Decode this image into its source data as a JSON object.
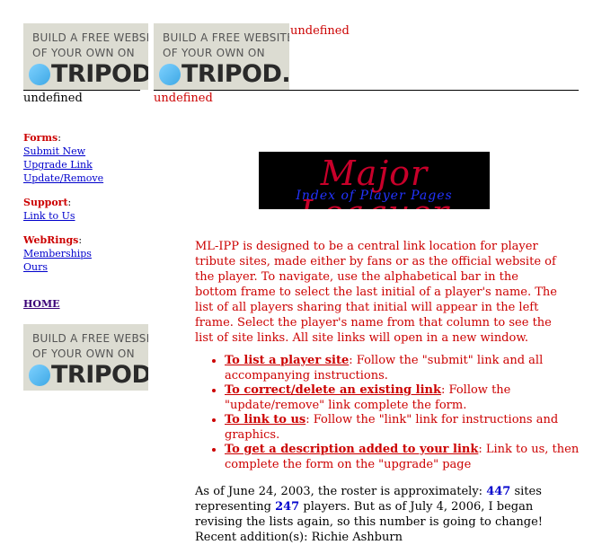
{
  "ads": {
    "line1": "BUILD A FREE WEBSITE",
    "line2": "OF YOUR OWN ON",
    "brand": "TRIPOD."
  },
  "undefined_text": "undefined",
  "nav": {
    "forms": {
      "heading": "Forms",
      "links": [
        "Submit New",
        "Upgrade Link",
        "Update/Remove"
      ]
    },
    "support": {
      "heading": "Support",
      "links": [
        "Link to Us"
      ]
    },
    "webrings": {
      "heading": "WebRings",
      "links": [
        "Memberships",
        "Ours"
      ]
    },
    "home": "HOME"
  },
  "banner": {
    "title": "Major Leaguer",
    "subtitle": "Index of Player Pages"
  },
  "intro": "ML-IPP is designed to be a central link location for player tribute sites, made either by fans or as the official website of the player. To navigate, use the alphabetical bar in the bottom frame to select the last initial of a player's name. The list of all players sharing that initial will appear in the left frame. Select the player's name from that column to see the list of site links. All site links will open in a new window.",
  "bullets": [
    {
      "link": "To list a player site",
      "text": ": Follow the \"submit\" link and all accompanying instructions."
    },
    {
      "link": "To correct/delete an existing link",
      "text": ": Follow the \"update/remove\" link complete the form."
    },
    {
      "link": "To link to us",
      "text": ": Follow the \"link\" link for instructions and graphics."
    },
    {
      "link": "To get a description added to your link",
      "text": ": Link to us, then complete the form on the \"upgrade\" page"
    }
  ],
  "stats": {
    "part1": "As of June 24, 2003, the roster is approximately: ",
    "sites": "447",
    "part2": " sites representing ",
    "players": "247",
    "part3": " players. But as of July 4, 2006, I began revising the lists again, so this number is going to change!",
    "recent": "Recent addition(s): Richie Ashburn"
  },
  "colors": {
    "accent_red": "#cc0000",
    "link_blue": "#0000cc",
    "ad_background": "#dcdcd2",
    "tripod_dot": "#3ea8e5",
    "banner_red": "#c8002a",
    "banner_blue": "#2233ff"
  },
  "icons": {
    "tripod_logo": "tripod-dot-icon"
  }
}
